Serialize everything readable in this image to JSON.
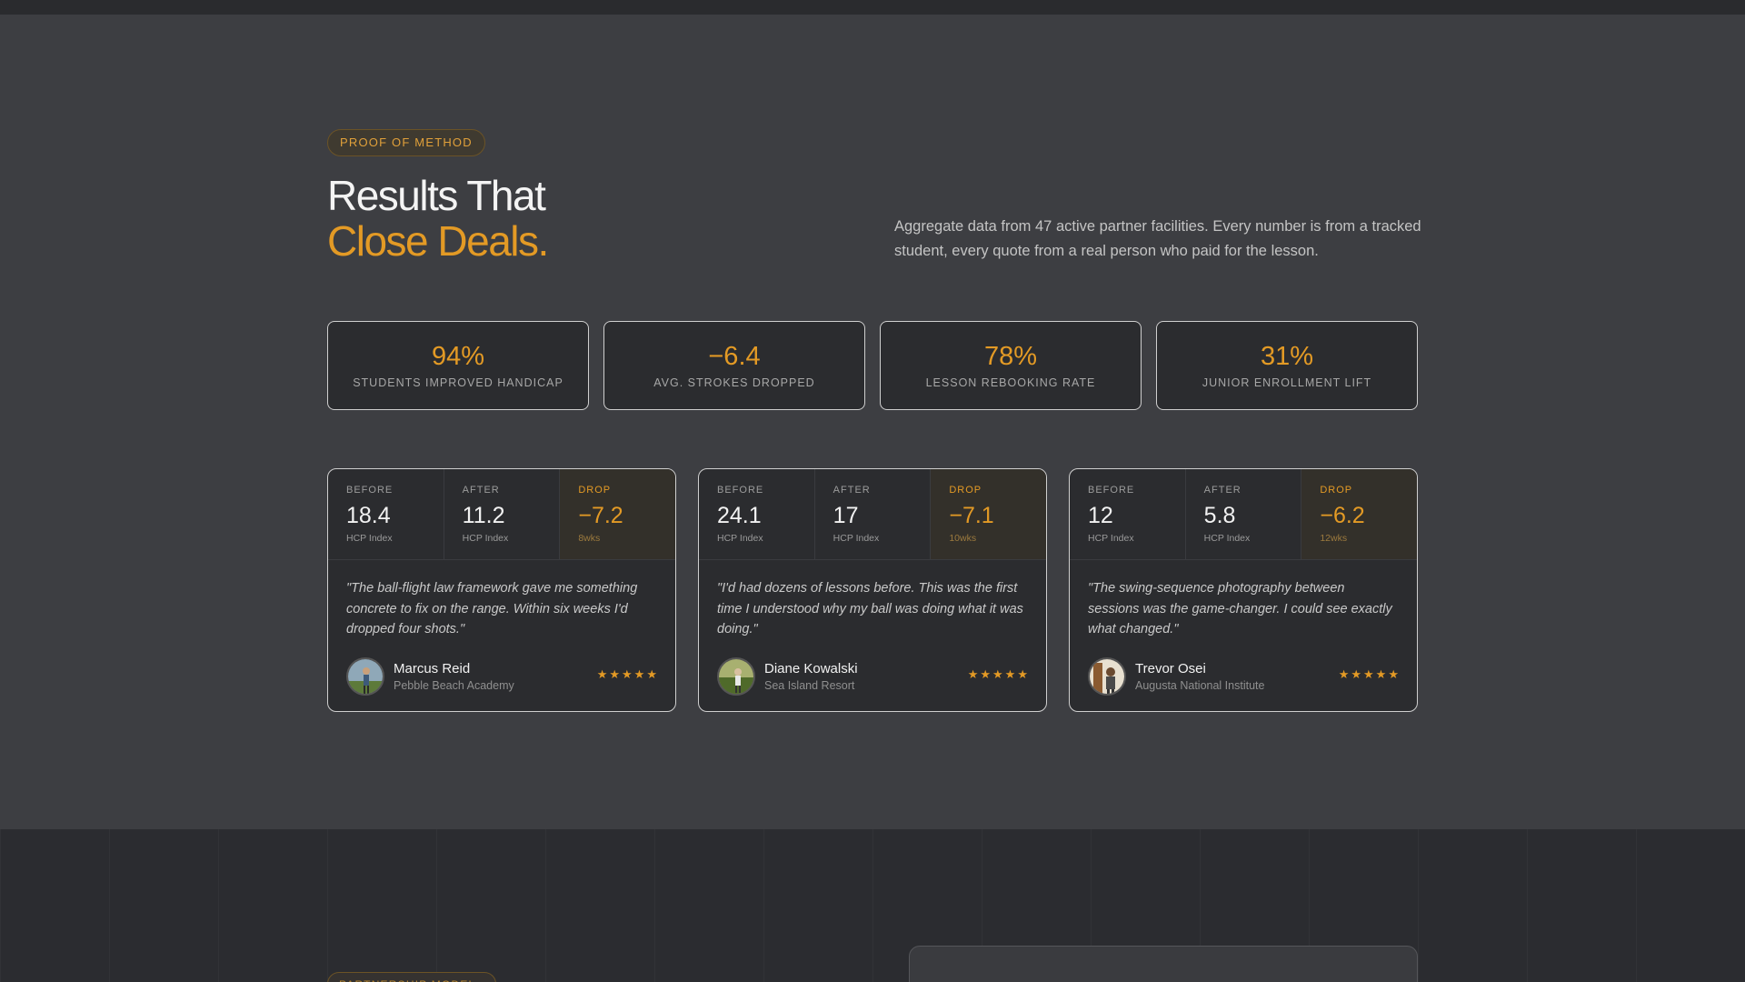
{
  "eyebrow": "PROOF OF METHOD",
  "headline": {
    "line1": "Results That",
    "line2": "Close Deals."
  },
  "lede": "Aggregate data from 47 active partner facilities. Every number is from a tracked student, every quote from a real person who paid for the lesson.",
  "stats": [
    {
      "value": "94%",
      "label": "STUDENTS IMPROVED HANDICAP"
    },
    {
      "value": "−6.4",
      "label": "AVG. STROKES DROPPED"
    },
    {
      "value": "78%",
      "label": "LESSON REBOOKING RATE"
    },
    {
      "value": "31%",
      "label": "JUNIOR ENROLLMENT LIFT"
    }
  ],
  "testimonials": [
    {
      "before": {
        "label": "BEFORE",
        "value": "18.4",
        "sub": "HCP Index"
      },
      "after": {
        "label": "AFTER",
        "value": "11.2",
        "sub": "HCP Index"
      },
      "drop": {
        "label": "DROP",
        "value": "−7.2",
        "sub": "8wks"
      },
      "quote": "\"The ball-flight law framework gave me something concrete to fix on the range. Within six weeks I'd dropped four shots.\"",
      "name": "Marcus Reid",
      "org": "Pebble Beach Academy",
      "stars": "★★★★★"
    },
    {
      "before": {
        "label": "BEFORE",
        "value": "24.1",
        "sub": "HCP Index"
      },
      "after": {
        "label": "AFTER",
        "value": "17",
        "sub": "HCP Index"
      },
      "drop": {
        "label": "DROP",
        "value": "−7.1",
        "sub": "10wks"
      },
      "quote": "\"I'd had dozens of lessons before. This was the first time I understood why my ball was doing what it was doing.\"",
      "name": "Diane Kowalski",
      "org": "Sea Island Resort",
      "stars": "★★★★★"
    },
    {
      "before": {
        "label": "BEFORE",
        "value": "12",
        "sub": "HCP Index"
      },
      "after": {
        "label": "AFTER",
        "value": "5.8",
        "sub": "HCP Index"
      },
      "drop": {
        "label": "DROP",
        "value": "−6.2",
        "sub": "12wks"
      },
      "quote": "\"The swing-sequence photography between sessions was the game-changer. I could see exactly what changed.\"",
      "name": "Trevor Osei",
      "org": "Augusta National Institute",
      "stars": "★★★★★"
    }
  ],
  "next_section_eyebrow": "PARTNERSHIP MODEL",
  "colors": {
    "accent": "#e39a25",
    "background": "#3d3e42",
    "card": "#2b2c2f"
  }
}
